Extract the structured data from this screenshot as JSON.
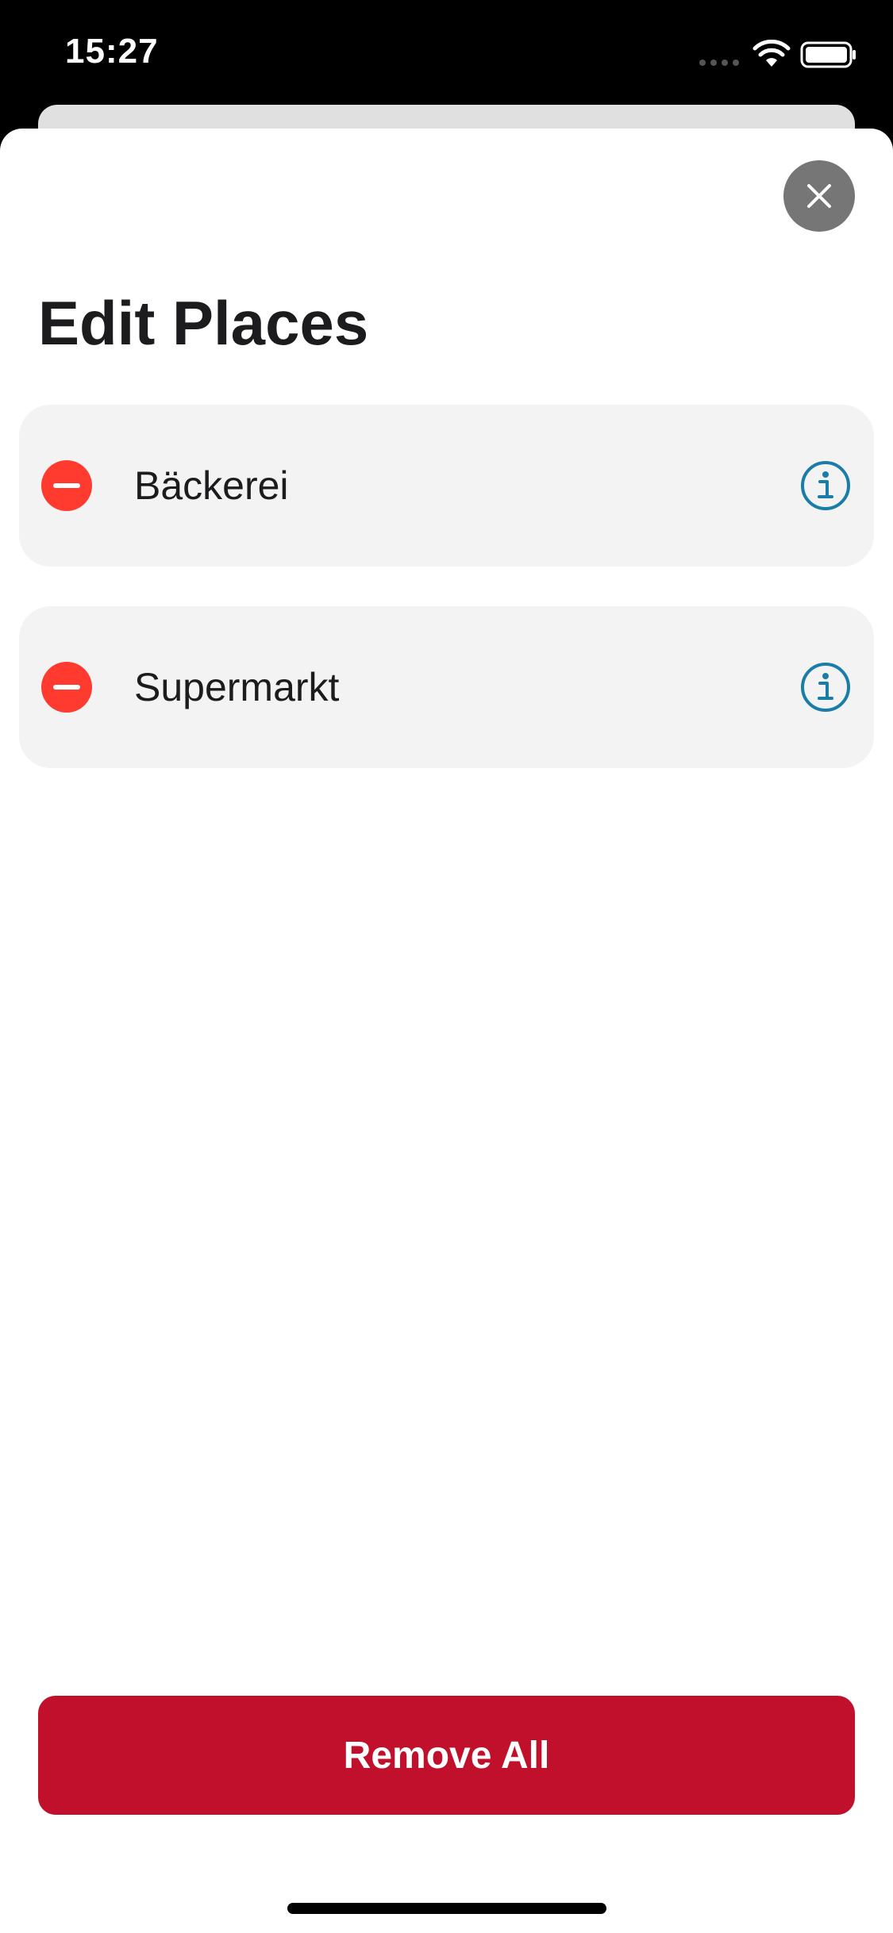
{
  "status_bar": {
    "time": "15:27",
    "icons": [
      "signal-dots-icon",
      "wifi-icon",
      "battery-icon"
    ]
  },
  "sheet": {
    "title": "Edit Places",
    "close_icon": "close-icon",
    "places": [
      {
        "label": "Bäckerei",
        "delete_icon": "minus-circle-icon",
        "info_icon": "info-icon"
      },
      {
        "label": "Supermarkt",
        "delete_icon": "minus-circle-icon",
        "info_icon": "info-icon"
      }
    ],
    "remove_all_label": "Remove All"
  },
  "colors": {
    "delete_red": "#ff3b30",
    "info_blue": "#1a7ca8",
    "remove_all_bg": "#c0102b",
    "close_bg": "#767676",
    "row_bg": "#f3f3f3"
  }
}
